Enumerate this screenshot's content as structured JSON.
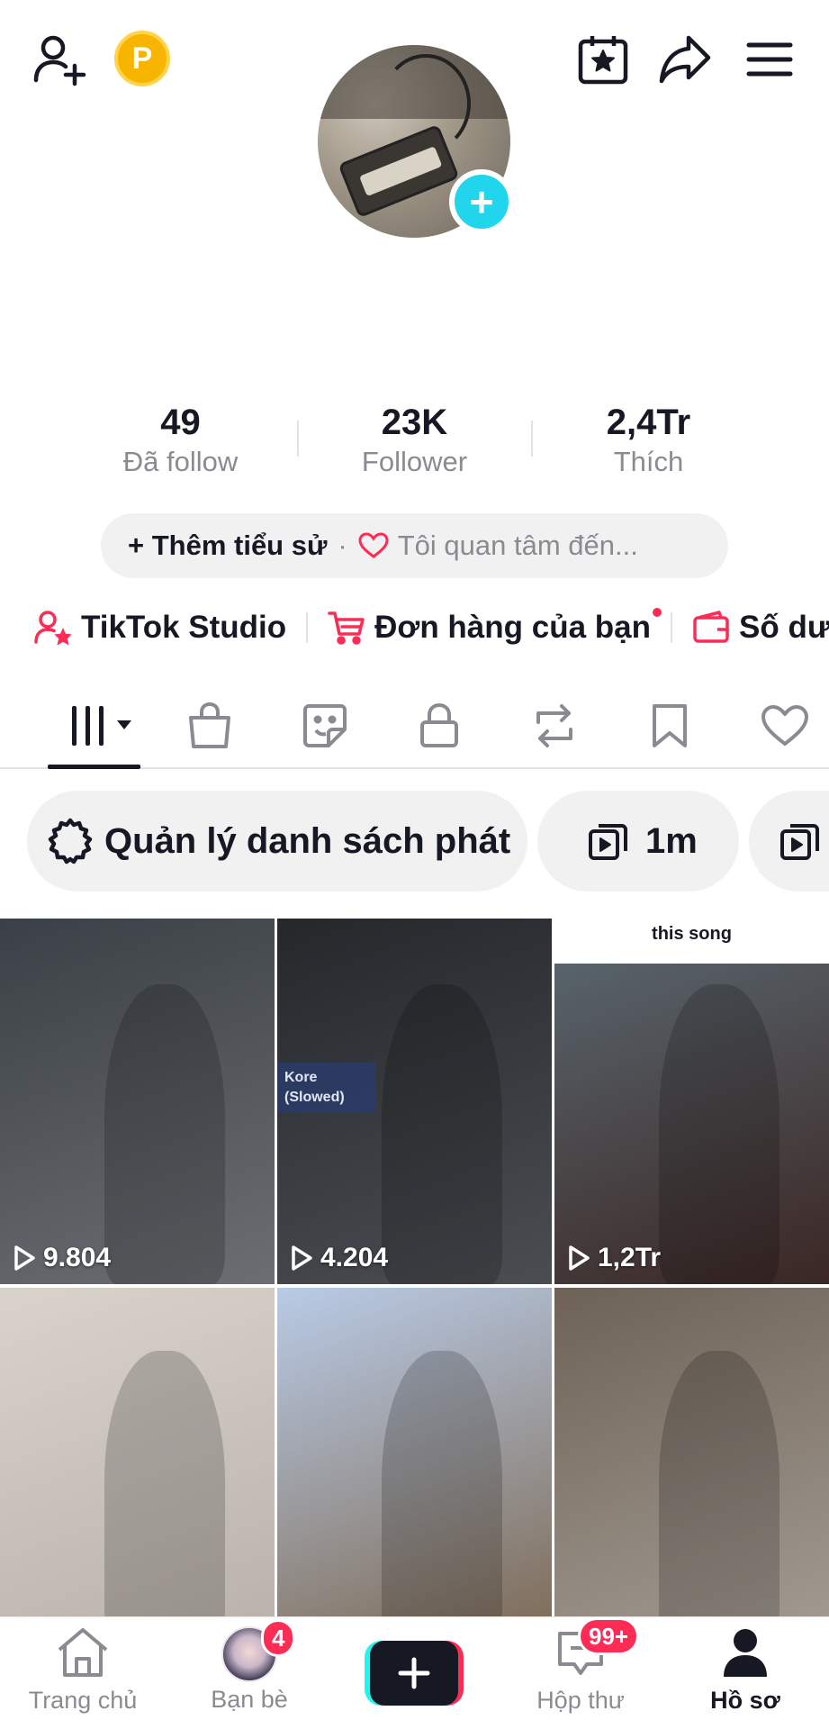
{
  "header": {
    "add_friend_icon": "person-plus-icon",
    "coin_label": "P",
    "calendar_icon": "calendar-star-icon",
    "share_icon": "share-arrow-icon",
    "menu_icon": "hamburger-menu-icon"
  },
  "profile": {
    "avatar_add_label": "+"
  },
  "stats": [
    {
      "value": "49",
      "label": "Đã follow"
    },
    {
      "value": "23K",
      "label": "Follower"
    },
    {
      "value": "2,4Tr",
      "label": "Thích"
    }
  ],
  "bio": {
    "add_label": "+ Thêm tiểu sử",
    "separator": "·",
    "interest_placeholder": "Tôi quan tâm đến..."
  },
  "shortcuts": [
    {
      "label": "TikTok Studio",
      "icon": "person-star-icon"
    },
    {
      "label": "Đơn hàng của bạn",
      "icon": "cart-icon"
    },
    {
      "label": "Số dư",
      "icon": "wallet-icon"
    }
  ],
  "tabs": [
    {
      "name": "videos",
      "icon": "grid-lines-icon"
    },
    {
      "name": "shop",
      "icon": "shopping-bag-icon"
    },
    {
      "name": "stickers",
      "icon": "sticker-icon"
    },
    {
      "name": "private",
      "icon": "lock-icon"
    },
    {
      "name": "reposts",
      "icon": "repost-icon"
    },
    {
      "name": "favorites",
      "icon": "bookmark-icon"
    },
    {
      "name": "liked",
      "icon": "heart-icon"
    }
  ],
  "chips": [
    {
      "label": "Quản lý danh sách phát",
      "icon": "gear-icon"
    },
    {
      "label": "1m",
      "icon": "playlist-icon"
    },
    {
      "label": "",
      "icon": "playlist-icon"
    }
  ],
  "videos": [
    {
      "views": "9.804",
      "overlay_text": "",
      "colors": [
        "#3b4046",
        "#6b6e72"
      ]
    },
    {
      "views": "4.204",
      "overlay_text": "Kore (Slowed)",
      "colors": [
        "#25272b",
        "#4a4d52"
      ]
    },
    {
      "views": "1,2Tr",
      "overlay_text": "this song",
      "colors": [
        "#5b6a73",
        "#3b2724"
      ]
    },
    {
      "views": "",
      "overlay_text": "",
      "colors": [
        "#d9d3cc",
        "#b9b1aa"
      ]
    },
    {
      "views": "",
      "overlay_text": "",
      "colors": [
        "#b9cbe6",
        "#7d6a55"
      ]
    },
    {
      "views": "",
      "overlay_text": "",
      "colors": [
        "#6e6257",
        "#a39c93"
      ]
    }
  ],
  "bottom_nav": [
    {
      "label": "Trang chủ",
      "icon": "home-icon"
    },
    {
      "label": "Bạn bè",
      "icon": "friends-avatar",
      "badge": "4"
    },
    {
      "label": "",
      "icon": "plus-icon"
    },
    {
      "label": "Hộp thư",
      "icon": "inbox-icon",
      "badge": "99+"
    },
    {
      "label": "Hồ sơ",
      "icon": "profile-icon"
    }
  ],
  "colors": {
    "accent": "#fe2c55",
    "cyan": "#25f4ee",
    "avatar_plus": "#20d5ec",
    "coin": "#f7b500"
  }
}
